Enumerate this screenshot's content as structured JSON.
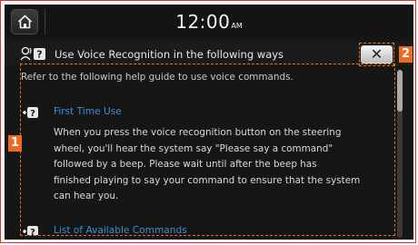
{
  "status_bar": {
    "time": "12:00",
    "ampm": "AM"
  },
  "header": {
    "title": "Use Voice Recognition in the following ways",
    "close_label": "✕"
  },
  "content": {
    "intro": "Refer to the following help guide to use voice commands.",
    "sections": [
      {
        "title": "First Time Use",
        "lines": [
          "When you press the voice recognition button on the steering",
          "wheel, you'll hear the system say \"Please say a command\"",
          "followed by a beep. Please wait until after the beep has",
          "finished playing to say your command to ensure that the system",
          "can hear you."
        ]
      },
      {
        "title": "List of Available Commands"
      }
    ]
  },
  "callouts": {
    "one": "1",
    "two": "2"
  },
  "colors": {
    "accent_link": "#3c8fd6",
    "callout": "#ec6b1e",
    "frame": "#e2301f"
  },
  "icons": {
    "home": "home-icon",
    "voice": "voice-help-icon",
    "help": "help-icon",
    "close": "close-icon"
  }
}
